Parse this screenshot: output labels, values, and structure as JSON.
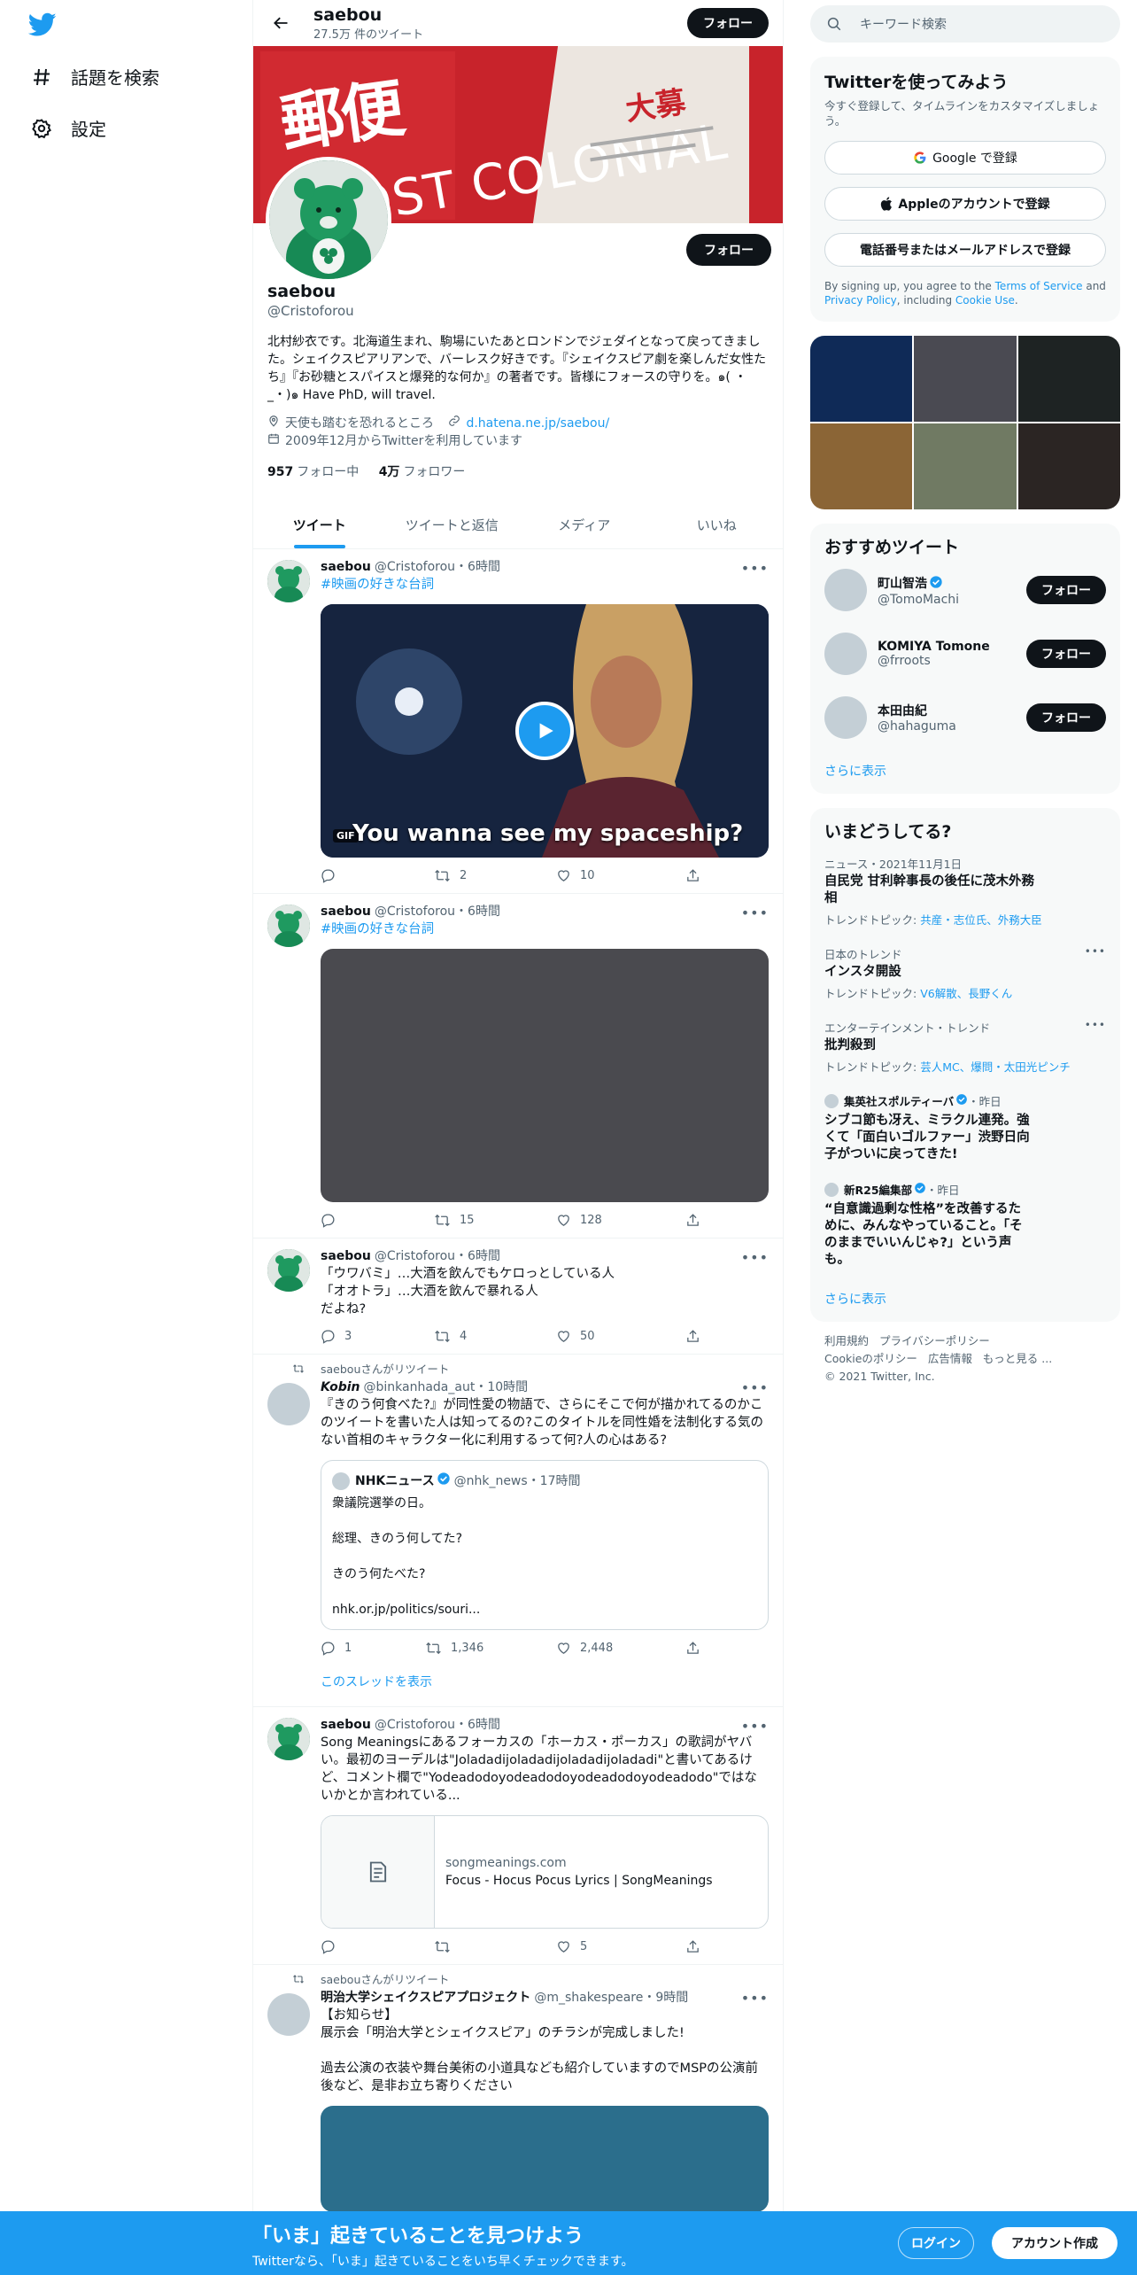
{
  "nav": {
    "explore_label": "話題を検索",
    "settings_label": "設定"
  },
  "header": {
    "name": "saebou",
    "tweet_count": "27.5万 件のツイート",
    "follow_label": "フォロー"
  },
  "banner": {
    "text_kanji": "郵便",
    "text_latin": "OST COLONIAL",
    "text_small": "大募"
  },
  "profile": {
    "name": "saebou",
    "handle": "@Cristoforou",
    "follow_label": "フォロー",
    "bio": "北村紗衣です。北海道生まれ、駒場にいたあとロンドンでジェダイとなって戻ってきました。シェイクスピアリアンで、バーレスク好きです。『シェイクスピア劇を楽しんだ女性たち』『お砂糖とスパイスと爆発的な何か』の著者です。皆様にフォースの守りを。๑( ・_・)๑ Have PhD, will travel.",
    "location": "天使も踏むを恐れるところ",
    "link": "d.hatena.ne.jp/saebou/",
    "joined": "2009年12月からTwitterを利用しています",
    "following_count": "957",
    "following_label": "フォロー中",
    "followers_count": "4万",
    "followers_label": "フォロワー"
  },
  "tabs": [
    "ツイート",
    "ツイートと返信",
    "メディア",
    "いいね"
  ],
  "tweets": [
    {
      "name": "saebou",
      "handle": "@Cristoforou",
      "time": "・6時間",
      "text": "#映画の好きな台詞",
      "gif_badge": "GIF",
      "gif_caption": "You wanna see my spaceship?",
      "replies": "",
      "retweets": "2",
      "likes": "10"
    },
    {
      "name": "saebou",
      "handle": "@Cristoforou",
      "time": "・6時間",
      "text": "#映画の好きな台詞",
      "replies": "",
      "retweets": "15",
      "likes": "128"
    },
    {
      "name": "saebou",
      "handle": "@Cristoforou",
      "time": "・6時間",
      "line1": "「ウワバミ」…大酒を飲んでもケロっとしている人",
      "line2": "「オオトラ」…大酒を飲んで暴れる人",
      "line3": "だよね?",
      "replies": "3",
      "retweets": "4",
      "likes": "50"
    },
    {
      "retweet_label": "saebouさんがリツイート",
      "name": "Kobin",
      "handle": "@binkanhada_aut",
      "time": "・10時間",
      "text": "『きのう何食べた?』が同性愛の物語で、さらにそこで何が描かれてるのかこのツイートを書いた人は知ってるの?このタイトルを同性婚を法制化する気のない首相のキャラクター化に利用するって何?人の心はある?",
      "quote_name": "NHKニュース",
      "quote_handle": "@nhk_news",
      "quote_time": "・17時間",
      "quote_line1": "衆議院選挙の日。",
      "quote_line2": "総理、きのう何してた?",
      "quote_line3": "きのう何たべた?",
      "quote_link": "nhk.or.jp/politics/souri...",
      "replies": "1",
      "retweets": "1,346",
      "likes": "2,448",
      "thread_label": "このスレッドを表示"
    },
    {
      "name": "saebou",
      "handle": "@Cristoforou",
      "time": "・6時間",
      "text": "Song Meaningsにあるフォーカスの「ホーカス・ポーカス」の歌詞がヤバい。最初のヨーデルは\"Joladadijoladadijoladadijoladadi\"と書いてあるけど、コメント欄で\"Yodeadodoyodeadodoyodeadodoyodeadodo\"ではないかとか言われている...",
      "card_domain": "songmeanings.com",
      "card_title": "Focus - Hocus Pocus Lyrics | SongMeanings",
      "replies": "",
      "retweets": "",
      "likes": "5"
    },
    {
      "retweet_label": "saebouさんがリツイート",
      "name": "明治大学シェイクスピアプロジェクト",
      "handle": "@m_shakespeare",
      "time": "・9時間",
      "line1": "【お知らせ】",
      "line2": "展示会「明治大学とシェイクスピア」のチラシが完成しました!",
      "line3": "過去公演の衣装や舞台美術の小道具なども紹介していますのでMSPの公演前後など、是非お立ち寄りください"
    }
  ],
  "sidebar": {
    "search_placeholder": "キーワード検索",
    "signup": {
      "title": "Twitterを使ってみよう",
      "subtitle": "今すぐ登録して、タイムラインをカスタマイズしましょう。",
      "google": "Google で登録",
      "apple": "Appleのアカウントで登録",
      "phone": "電話番号またはメールアドレスで登録",
      "terms_1": "By signing up, you agree to the ",
      "terms_link1": "Terms of Service",
      "terms_2": " and ",
      "terms_link2": "Privacy Policy",
      "terms_3": ", including ",
      "terms_link3": "Cookie Use",
      "terms_4": "."
    },
    "photo_colors": [
      "#0f2a57",
      "#4a4a52",
      "#1e2323",
      "#8b6536",
      "#707a63",
      "#2b2523"
    ],
    "who": {
      "title": "おすすめツイート",
      "follow_label": "フォロー",
      "users": [
        {
          "name": "町山智浩",
          "handle": "@TomoMachi",
          "verified": true
        },
        {
          "name": "KOMIYA Tomone",
          "handle": "@frroots",
          "verified": false
        },
        {
          "name": "本田由紀",
          "handle": "@hahaguma",
          "verified": false
        }
      ],
      "more": "さらに表示"
    },
    "trends": {
      "title": "いまどうしてる?",
      "items": [
        {
          "ctx": "ニュース・2021年11月1日",
          "title": "自民党 甘利幹事長の後任に茂木外務相",
          "sub_label": "トレンドトピック: ",
          "sub_links": "共産・志位氏、外務大臣"
        },
        {
          "ctx": "日本のトレンド",
          "title": "インスタ開設",
          "sub_label": "トレンドトピック: ",
          "sub_links": "V6解散、長野くん"
        },
        {
          "ctx": "エンターテインメント・トレンド",
          "title": "批判殺到",
          "sub_label": "トレンドトピック: ",
          "sub_links": "芸人MC、爆問・太田光ピンチ"
        },
        {
          "source": "集英社スポルティーバ",
          "time": "・昨日",
          "title": "シブコ節も冴え、ミラクル連発。強くて「面白いゴルファー」渋野日向子がついに戻ってきた!"
        },
        {
          "source": "新R25編集部",
          "time": "・昨日",
          "title": "“自意識過剰な性格”を改善するために、みんなやっていること。「そのままでいいんじゃ?」という声も。"
        }
      ],
      "more": "さらに表示"
    },
    "footer": {
      "links1": [
        "利用規約",
        "プライバシーポリシー"
      ],
      "links2": [
        "Cookieのポリシー",
        "広告情報",
        "もっと見る ..."
      ],
      "copyright": "© 2021 Twitter, Inc."
    }
  },
  "bottombar": {
    "title": "「いま」起きていることを見つけよう",
    "subtitle": "Twitterなら、「いま」起きていることをいち早くチェックできます。",
    "login": "ログイン",
    "signup": "アカウント作成"
  }
}
